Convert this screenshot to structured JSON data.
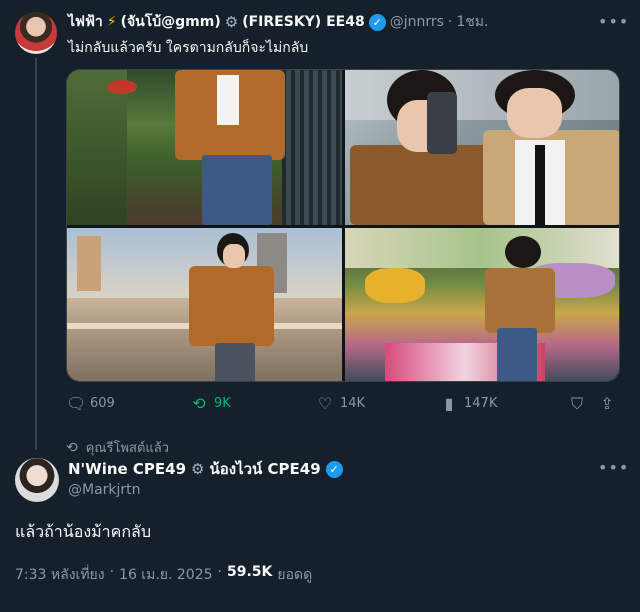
{
  "quoted": {
    "display_name_part1": "ไฟฟ้า",
    "bolt": "⚡",
    "display_name_part2": "(จันโบ้@gmm)",
    "display_name_part3": "(FIRESKY) EE48",
    "handle": "@jnnrrs",
    "separator": "·",
    "time": "1ชม.",
    "text": "ไม่กลับแล้วครับ ใครตามกลับก็จะไม่กลับ",
    "stats": {
      "replies": "609",
      "reposts": "9K",
      "likes": "14K",
      "views": "147K"
    }
  },
  "repost_label": "คุณรีโพสต์แล้ว",
  "main": {
    "display_name_part1": "N'Wine CPE49",
    "display_name_part2": "น้องไวน์ CPE49",
    "handle": "@Markjrtn",
    "text": "แล้วถ้าน้องม้าคกลับ",
    "time": "7:33 หลังเที่ยง",
    "separator": "·",
    "date": "16 เม.ย. 2025",
    "views_count": "59.5K",
    "views_label": "ยอดดู"
  },
  "icons": {
    "more": "more-horizontal-icon",
    "gear": "gear-icon",
    "verified": "verified-badge-icon",
    "reply": "reply-icon",
    "repost": "repost-icon",
    "like": "heart-icon",
    "views": "analytics-icon",
    "bookmark": "bookmark-icon",
    "share": "share-icon"
  },
  "colors": {
    "background": "#15202b",
    "accent": "#1d9bf0",
    "repost_active": "#00ba7c",
    "muted": "#8b98a5"
  }
}
